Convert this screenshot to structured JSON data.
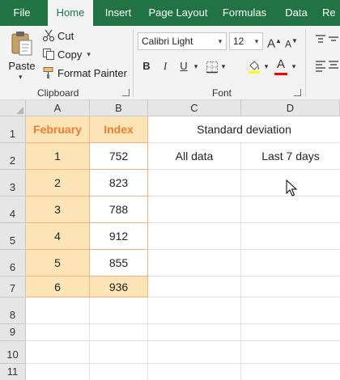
{
  "ribbon_tabs": [
    "File",
    "Home",
    "Insert",
    "Page Layout",
    "Formulas",
    "Data",
    "Re"
  ],
  "active_tab": "Home",
  "clipboard": {
    "paste_label": "Paste",
    "cut_label": "Cut",
    "copy_label": "Copy",
    "format_painter_label": "Format Painter",
    "group_label": "Clipboard"
  },
  "font": {
    "name": "Calibri Light",
    "size": "12",
    "group_label": "Font",
    "bold_label": "B",
    "italic_label": "I",
    "underline_label": "U",
    "grow_label": "A",
    "shrink_label": "A",
    "font_color_label": "A"
  },
  "columns": [
    "A",
    "B",
    "C",
    "D"
  ],
  "rows": [
    "1",
    "2",
    "3",
    "4",
    "5",
    "6",
    "7",
    "8",
    "9",
    "10",
    "11"
  ],
  "table": {
    "headers": [
      "February",
      "Index"
    ],
    "months": [
      "1",
      "2",
      "3",
      "4",
      "5",
      "6"
    ],
    "values": [
      "752",
      "823",
      "788",
      "912",
      "855",
      "936"
    ]
  },
  "cells": {
    "c1": "Standard deviation",
    "c2": "All data",
    "d2": "Last 7 days"
  },
  "colors": {
    "ribbon_green": "#217346",
    "table_header_text": "#ed7d31",
    "table_fill": "#fce4b6",
    "table_border": "#f4b183"
  }
}
